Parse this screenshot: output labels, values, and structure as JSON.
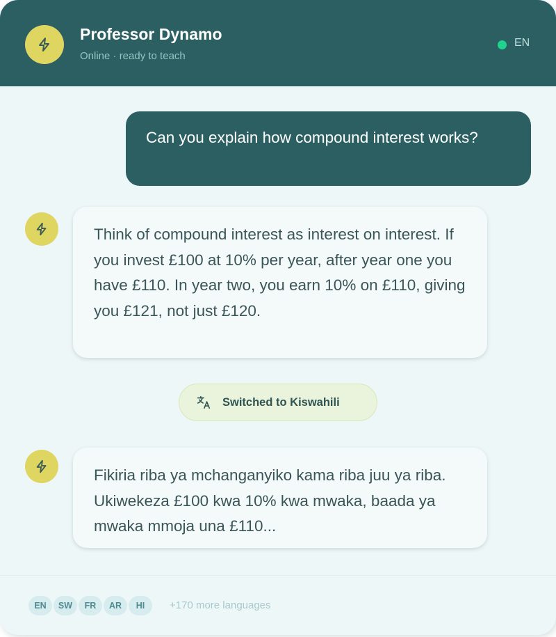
{
  "header": {
    "name": "Professor Dynamo",
    "status": "Online · ready to teach",
    "language_code": "EN",
    "avatar_icon": "lightning-bolt-icon"
  },
  "messages": [
    {
      "role": "user",
      "text": "Can you explain how compound interest works?"
    },
    {
      "role": "assistant",
      "text": "Think of compound interest as interest on interest. If you invest £100 at 10% per year, after year one you have £110. In year two, you earn 10% on £110, giving you £121, not just £120."
    },
    {
      "role": "system",
      "text": "Switched to Kiswahili",
      "icon": "translate-icon"
    },
    {
      "role": "assistant",
      "text": "Fikiria riba ya mchanganyiko kama riba juu ya riba. Ukiwekeza £100 kwa 10% kwa mwaka, baada ya mwaka mmoja una £110..."
    }
  ],
  "footer": {
    "languages": [
      "EN",
      "SW",
      "FR",
      "AR",
      "HI"
    ],
    "more_label": "+170 more languages"
  },
  "colors": {
    "header_bg": "#2c5f62",
    "accent_yellow": "#dfd561",
    "online_green": "#1fd38f",
    "chat_bg": "#eef7f8"
  }
}
